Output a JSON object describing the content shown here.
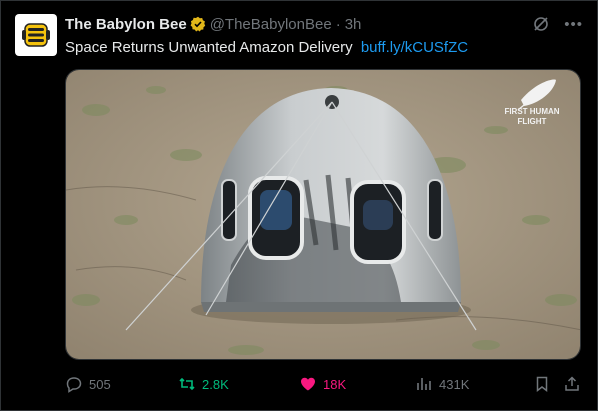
{
  "tweet": {
    "author_name": "The Babylon Bee",
    "handle": "@TheBabylonBee",
    "separator": "·",
    "time": "3h",
    "text": "Space Returns Unwanted Amazon Delivery",
    "link": "buff.ly/kCUSfZC",
    "media_watermark": [
      "FIRST HUMAN",
      "FLIGHT"
    ],
    "stats": {
      "replies": "505",
      "reposts": "2.8K",
      "likes": "18K",
      "views": "431K"
    }
  },
  "colors": {
    "background": "#000000",
    "link": "#1d9bf0",
    "verified": "#e2b719",
    "repost": "#00ba7c",
    "like": "#f91880",
    "muted": "#71767b"
  },
  "icons": [
    "babylon-bee-logo-icon",
    "verified-badge-icon",
    "grok-icon",
    "more-icon",
    "reply-icon",
    "repost-icon",
    "heart-icon",
    "views-icon",
    "bookmark-icon",
    "share-icon",
    "feather-icon"
  ]
}
